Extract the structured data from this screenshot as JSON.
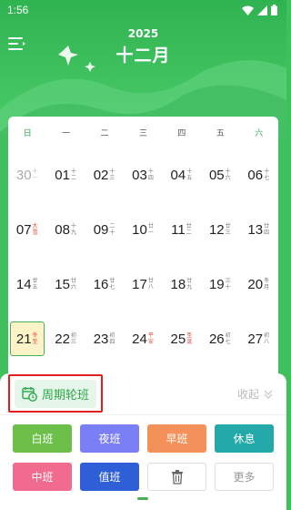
{
  "status": {
    "time": "1:56"
  },
  "header": {
    "year": "2025",
    "month": "十二月"
  },
  "weekdays": [
    "日",
    "一",
    "二",
    "三",
    "四",
    "五",
    "六"
  ],
  "weeks": [
    [
      {
        "num": "30",
        "sub": "十一",
        "muted": true
      },
      {
        "num": "01",
        "sub": "十二"
      },
      {
        "num": "02",
        "sub": "十三"
      },
      {
        "num": "03",
        "sub": "十四"
      },
      {
        "num": "04",
        "sub": "十五"
      },
      {
        "num": "05",
        "sub": "十六"
      },
      {
        "num": "06",
        "sub": "十七"
      }
    ],
    [
      {
        "num": "07",
        "sub": "大雪",
        "red": true
      },
      {
        "num": "08",
        "sub": "十九"
      },
      {
        "num": "09",
        "sub": "二十"
      },
      {
        "num": "10",
        "sub": "廿一"
      },
      {
        "num": "11",
        "sub": "廿二"
      },
      {
        "num": "12",
        "sub": "廿三"
      },
      {
        "num": "13",
        "sub": "廿四"
      }
    ],
    [
      {
        "num": "14",
        "sub": "廿五"
      },
      {
        "num": "15",
        "sub": "廿六"
      },
      {
        "num": "16",
        "sub": "廿七"
      },
      {
        "num": "17",
        "sub": "廿八"
      },
      {
        "num": "18",
        "sub": "廿九"
      },
      {
        "num": "19",
        "sub": "三十"
      },
      {
        "num": "20",
        "sub": "冬月"
      }
    ],
    [
      {
        "num": "21",
        "sub": "冬至",
        "red": true,
        "selected": true
      },
      {
        "num": "22",
        "sub": "初三"
      },
      {
        "num": "23",
        "sub": "初四"
      },
      {
        "num": "24",
        "sub": "平安",
        "red": true
      },
      {
        "num": "25",
        "sub": "圣诞",
        "red": true
      },
      {
        "num": "26",
        "sub": "初七"
      },
      {
        "num": "27",
        "sub": "初八"
      }
    ]
  ],
  "sheet": {
    "rotation_label": "周期轮班",
    "collapse_label": "收起"
  },
  "shifts": [
    {
      "label": "白班",
      "color": "#6cc04a",
      "name": "shift-day-button"
    },
    {
      "label": "夜班",
      "color": "#7b7ff5",
      "name": "shift-night-button"
    },
    {
      "label": "早班",
      "color": "#f4915a",
      "name": "shift-early-button"
    },
    {
      "label": "休息",
      "color": "#23a9a9",
      "name": "shift-rest-button"
    },
    {
      "label": "中班",
      "color": "#f06b8d",
      "name": "shift-middle-button"
    },
    {
      "label": "值班",
      "color": "#2f5fd6",
      "name": "shift-duty-button"
    },
    {
      "label": "",
      "icon": "trash-icon",
      "outline": true,
      "name": "delete-button"
    },
    {
      "label": "更多",
      "outline": true,
      "name": "more-button"
    }
  ],
  "colors": {
    "accent": "#2da84a",
    "highlight": "#fdf3c8",
    "alert": "#e02020"
  }
}
